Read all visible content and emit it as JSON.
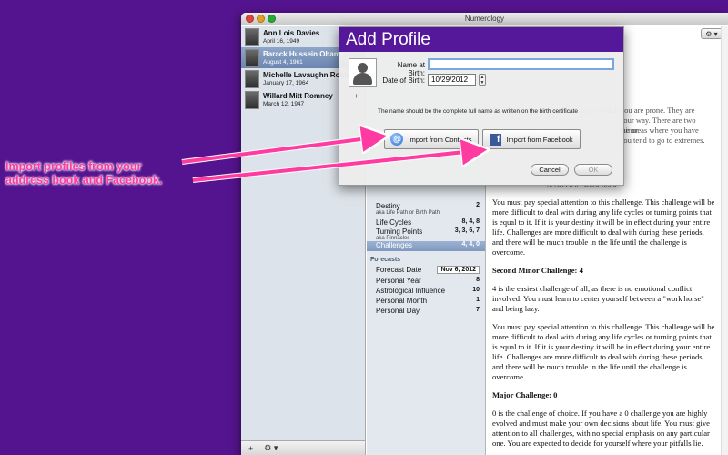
{
  "window": {
    "title": "Numerology"
  },
  "profiles": [
    {
      "name": "Ann Lois Davies",
      "date": "April 16, 1949"
    },
    {
      "name": "Barack Hussein Obama",
      "date": "August 4, 1961"
    },
    {
      "name": "Michelle Lavaughn Robinson",
      "date": "January 17, 1964"
    },
    {
      "name": "Willard Mitt Romney",
      "date": "March 12, 1947"
    }
  ],
  "sidebar_bottom": {
    "add": "+",
    "gear": "⚙ ▾"
  },
  "middle": {
    "rows": [
      {
        "label": "Destiny",
        "sub": "aka Life Path or Birth Path",
        "value": "2"
      },
      {
        "label": "Life Cycles",
        "value": "8, 4, 8"
      },
      {
        "label": "Turning Points",
        "sub": "aka Pinnacles",
        "value": "3, 3, 6, 7"
      },
      {
        "label": "Challenges",
        "value": "4, 4, 0"
      }
    ],
    "forecasts_label": "Forecasts",
    "forecast_rows": [
      {
        "label": "Forecast Date",
        "value": "Nov 6, 2012"
      },
      {
        "label": "Personal Year",
        "value": "8"
      },
      {
        "label": "Astrological Influence",
        "value": "10"
      },
      {
        "label": "Personal Month",
        "value": "1"
      },
      {
        "label": "Personal Day",
        "value": "7"
      }
    ]
  },
  "content": {
    "ghost_1": "The challenges are weaknesses to which you are prone. They are",
    "ghost_2": "your way. There are two minor",
    "ghost_3": "the areas where you have",
    "ghost_4": "you tend to go to extremes.",
    "ghost_5": "no emotional conflict",
    "ghost_6": "between a \"work horse\"",
    "paragraphs": [
      "You must pay special attention to this challenge. This challenge will be more difficult to deal with during any life cycles or turning points that is equal to it. If it is your destiny it will be in effect during your entire life. Challenges are more difficult to deal with during these periods, and there will be much trouble in the life until the challenge is overcome.",
      "Second Minor Challenge: 4",
      "4 is the easiest challenge of all, as there is no emotional conflict involved. You must learn to center yourself between a \"work horse\" and being lazy.",
      "You must pay special attention to this challenge. This challenge will be more difficult to deal with during any life cycles or turning points that is equal to it. If it is your destiny it will be in effect during your entire life. Challenges are more difficult to deal with during these periods, and there will be much trouble in the life until the challenge is overcome.",
      "Major Challenge: 0",
      "0 is the challenge of choice. If you have a 0 challenge you are highly evolved and must make your own decisions about life. You must give attention to all challenges, with no special emphasis on any particular one. You are expected to decide for yourself where your pitfalls lie."
    ]
  },
  "sheet": {
    "title": "Add Profile",
    "name_label": "Name at Birth:",
    "name_value": "",
    "date_label": "Date of Birth:",
    "date_value": "10/29/2012",
    "photo_add": "+",
    "photo_remove": "−",
    "hint": "The name should be the complete full name as written on the birth certificate",
    "contacts_button": "Import from Contacts",
    "facebook_button": "Import from Facebook",
    "cancel_button": "Cancel",
    "ok_button": "OK"
  },
  "callout": {
    "line1": "Import profiles from your",
    "line2": "address book and Facebook."
  },
  "colors": {
    "background": "#55148f",
    "sheet_header": "#56189a",
    "callout": "#ff3aa0"
  }
}
